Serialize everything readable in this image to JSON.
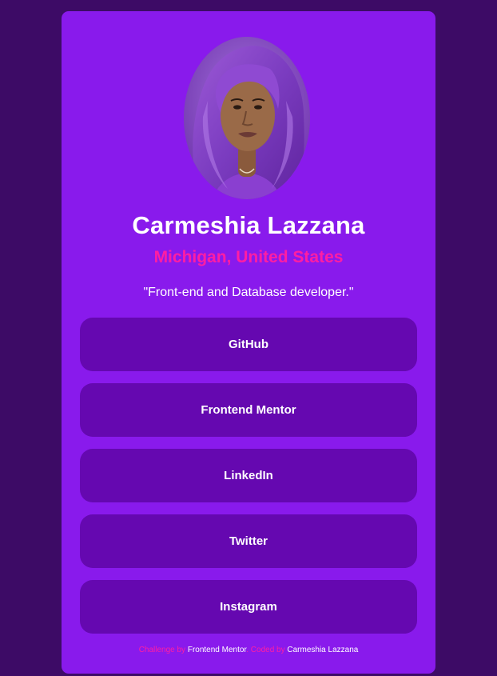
{
  "profile": {
    "name": "Carmeshia Lazzana",
    "location": "Michigan, United States",
    "bio": "\"Front-end and Database developer.\""
  },
  "links": [
    {
      "label": "GitHub"
    },
    {
      "label": "Frontend Mentor"
    },
    {
      "label": "LinkedIn"
    },
    {
      "label": "Twitter"
    },
    {
      "label": "Instagram"
    }
  ],
  "footer": {
    "challenge_prefix": "Challenge by ",
    "challenge_link": "Frontend Mentor",
    "separator": ". ",
    "coded_prefix": "Coded by ",
    "coded_link": "Carmeshia Lazzana"
  },
  "colors": {
    "page_background": "#3d0b66",
    "card_background": "#891aec",
    "button_background": "#6508b0",
    "accent": "#ff1ea3",
    "text": "#ffffff"
  }
}
